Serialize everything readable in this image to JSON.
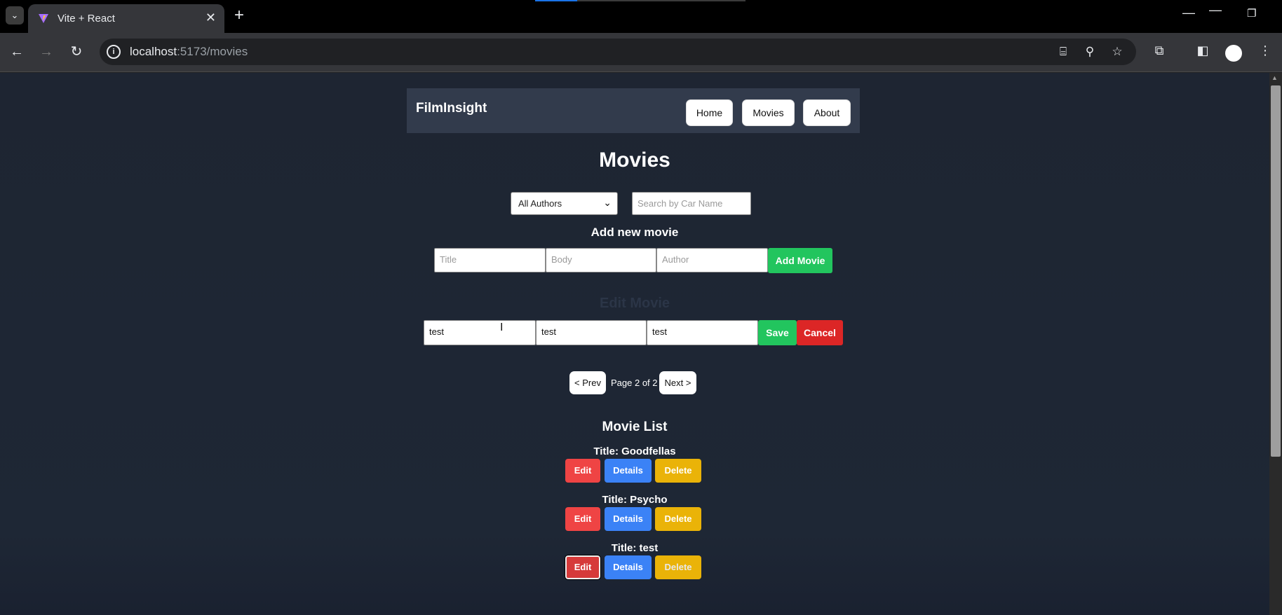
{
  "browser": {
    "tab_title": "Vite + React",
    "url_host": "localhost",
    "url_path": ":5173/movies"
  },
  "navbar": {
    "brand": "FilmInsight",
    "links": [
      "Home",
      "Movies",
      "About"
    ]
  },
  "page": {
    "heading": "Movies",
    "filter": {
      "selected": "All Authors",
      "search_placeholder": "Search by Car Name"
    },
    "add_section": {
      "heading": "Add new movie",
      "title_placeholder": "Title",
      "body_placeholder": "Body",
      "author_placeholder": "Author",
      "submit_label": "Add Movie"
    },
    "edit_section": {
      "heading": "Edit Movie",
      "title_value": "test",
      "body_value": "test",
      "author_value": "test",
      "save_label": "Save",
      "cancel_label": "Cancel"
    },
    "pagination": {
      "prev_label": "< Prev",
      "status": "Page 2 of 2",
      "next_label": "Next >"
    },
    "list": {
      "heading": "Movie List",
      "items": [
        {
          "title": "Title: Goodfellas"
        },
        {
          "title": "Title: Psycho"
        },
        {
          "title": "Title: test"
        }
      ],
      "edit_label": "Edit",
      "details_label": "Details",
      "delete_label": "Delete"
    }
  },
  "colors": {
    "page_bg": "#1e2532",
    "navbar_bg": "#323b4c",
    "green": "#22c55e",
    "red": "#dc2626",
    "blue": "#3b82f6",
    "yellow": "#eab308"
  }
}
